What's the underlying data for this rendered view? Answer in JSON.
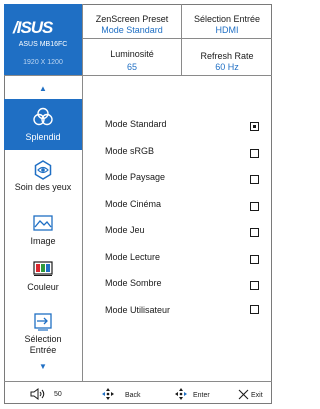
{
  "brand": {
    "logo": "/ISUS",
    "model": "ASUS MB16FC",
    "resolution": "1920 X 1200"
  },
  "header": {
    "preset_label": "ZenScreen Preset",
    "preset_value": "Mode Standard",
    "input_label": "Sélection Entrée",
    "input_value": "HDMI",
    "brightness_label": "Luminosité",
    "brightness_value": "65",
    "refresh_label": "Refresh Rate",
    "refresh_value": "60 Hz"
  },
  "nav": {
    "items": [
      {
        "label": "Splendid",
        "icon": "splendid-icon",
        "active": true
      },
      {
        "label": "Soin des yeux",
        "icon": "eye-care-icon",
        "active": false
      },
      {
        "label": "Image",
        "icon": "image-icon",
        "active": false
      },
      {
        "label": "Couleur",
        "icon": "color-icon",
        "active": false
      },
      {
        "label": "Sélection\nEntrée",
        "label1": "Sélection",
        "label2": "Entrée",
        "icon": "input-select-icon",
        "active": false
      }
    ]
  },
  "options": [
    {
      "label": "Mode Standard",
      "checked": true
    },
    {
      "label": "Mode sRGB",
      "checked": false
    },
    {
      "label": "Mode Paysage",
      "checked": false
    },
    {
      "label": "Mode Cinéma",
      "checked": false
    },
    {
      "label": "Mode Jeu",
      "checked": false
    },
    {
      "label": "Mode Lecture",
      "checked": false
    },
    {
      "label": "Mode Sombre",
      "checked": false
    },
    {
      "label": "Mode Utilisateur",
      "checked": false
    }
  ],
  "footer": {
    "volume": "50",
    "back": "Back",
    "enter": "Enter",
    "exit": "Exit"
  },
  "colors": {
    "accent": "#1f6fc4",
    "text": "#1a1a1a",
    "border": "#8a8a8a"
  }
}
